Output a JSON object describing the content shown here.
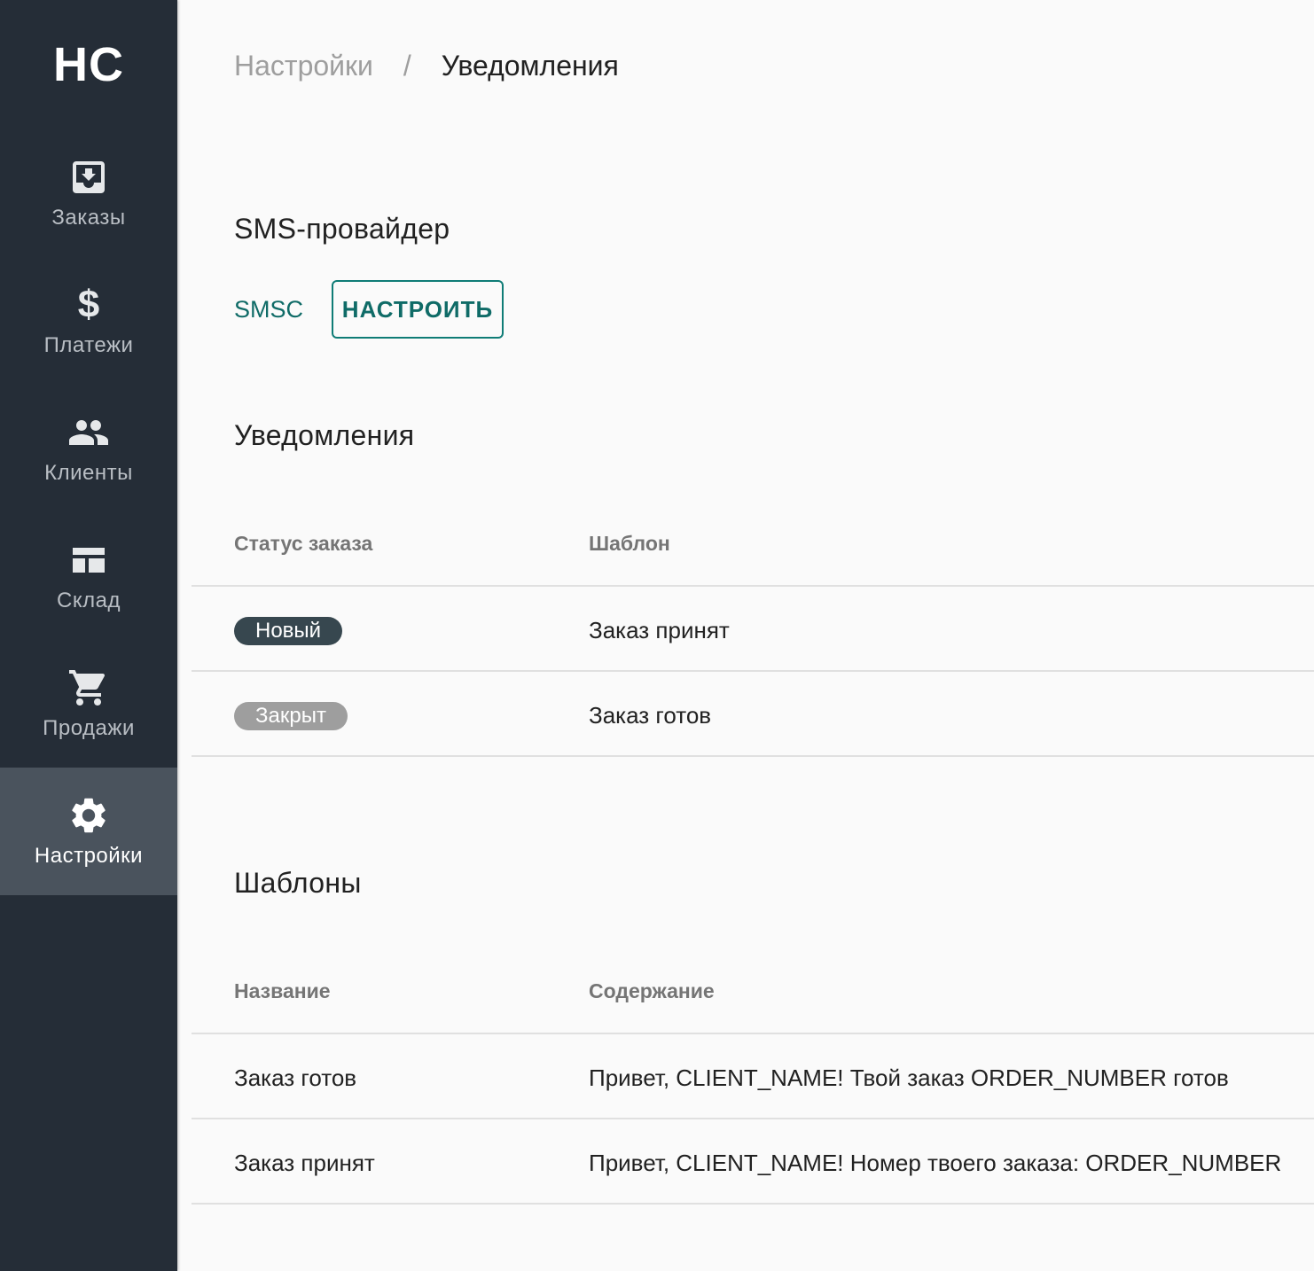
{
  "logo": "HC",
  "sidebar": {
    "items": [
      {
        "label": "Заказы",
        "icon": "inbox-download-icon"
      },
      {
        "label": "Платежи",
        "icon": "dollar-icon"
      },
      {
        "label": "Клиенты",
        "icon": "people-icon"
      },
      {
        "label": "Склад",
        "icon": "warehouse-grid-icon"
      },
      {
        "label": "Продажи",
        "icon": "cart-icon"
      },
      {
        "label": "Настройки",
        "icon": "gear-icon",
        "active": true
      }
    ]
  },
  "breadcrumb": {
    "parent": "Настройки",
    "separator": "/",
    "current": "Уведомления"
  },
  "sms_provider": {
    "title": "SMS-провайдер",
    "name": "SMSC",
    "button": "НАСТРОИТЬ"
  },
  "notifications": {
    "title": "Уведомления",
    "columns": [
      "Статус заказа",
      "Шаблон"
    ],
    "rows": [
      {
        "status": "Новый",
        "template": "Заказ принят"
      },
      {
        "status": "Закрыт",
        "template": "Заказ готов"
      }
    ]
  },
  "templates": {
    "title": "Шаблоны",
    "columns": [
      "Название",
      "Содержание"
    ],
    "rows": [
      {
        "name": "Заказ готов",
        "content": "Привет, CLIENT_NAME! Твой заказ ORDER_NUMBER готов"
      },
      {
        "name": "Заказ принят",
        "content": "Привет, CLIENT_NAME! Номер твоего заказа: ORDER_NUMBER"
      }
    ]
  },
  "colors": {
    "sidebar": "#252d37",
    "active": "#4a535d",
    "accent": "#0f6b67",
    "chip_new": "#37474f",
    "chip_closed": "#9e9e9e"
  }
}
